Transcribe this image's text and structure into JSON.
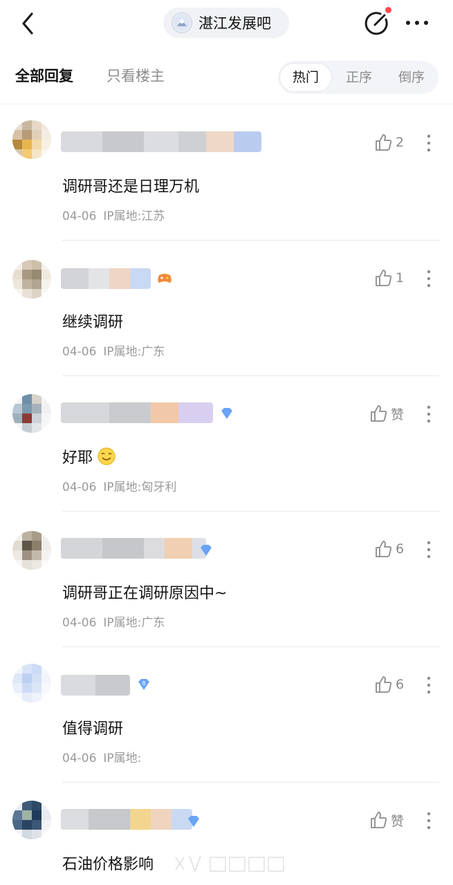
{
  "header": {
    "forum_name": "湛江发展吧",
    "back_icon": "chevron-left-icon",
    "post_icon": "edit-post-icon",
    "more_icon": "more-horizontal-icon"
  },
  "tabs": {
    "all_replies": "全部回复",
    "op_only": "只看楼主",
    "sort": [
      "热门",
      "正序",
      "倒序"
    ],
    "active_sort": "热门"
  },
  "comments": [
    {
      "text": "调研哥还是日理万机",
      "date": "04-06",
      "ip": "IP属地:江苏",
      "likes": "2"
    },
    {
      "text": "继续调研",
      "date": "04-06",
      "ip": "IP属地:广东",
      "likes": "1"
    },
    {
      "text": "好耶",
      "date": "04-06",
      "ip": "IP属地:匈牙利",
      "likes": "赞",
      "emoji": "smile-emoji"
    },
    {
      "text": "调研哥正在调研原因中~",
      "date": "04-06",
      "ip": "IP属地:广东",
      "likes": "6"
    },
    {
      "text": "值得调研",
      "date": "04-06",
      "ip": "IP属地:",
      "likes": "6"
    },
    {
      "text": "石油价格影响",
      "date": "",
      "ip": "",
      "likes": "赞"
    }
  ],
  "colors": {
    "accent_red": "#ff4a4a",
    "text_primary": "#141414",
    "text_secondary": "#9a9a9a"
  }
}
